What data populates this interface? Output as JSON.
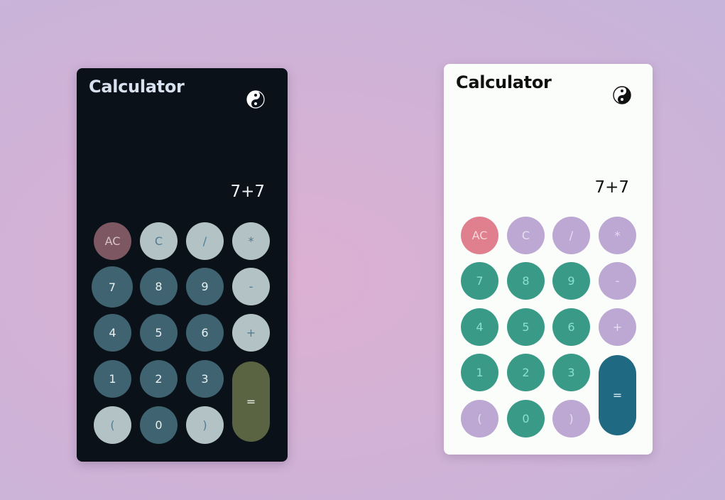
{
  "calculators": {
    "dark": {
      "title": "Calculator",
      "display": "7+7",
      "buttons": {
        "ac": "AC",
        "c": "C",
        "div": "/",
        "mul": "*",
        "n7": "7",
        "n8": "8",
        "n9": "9",
        "minus": "-",
        "n4": "4",
        "n5": "5",
        "n6": "6",
        "plus": "+",
        "n1": "1",
        "n2": "2",
        "n3": "3",
        "eq": "=",
        "lparen": "(",
        "n0": "0",
        "rparen": ")"
      },
      "colors": {
        "background": "#0b1118",
        "number": "#3f6371",
        "operator": "#b3c2c5",
        "clear": "#7d5762",
        "equals": "#5a6443"
      }
    },
    "light": {
      "title": "Calculator",
      "display": "7+7",
      "buttons": {
        "ac": "AC",
        "c": "C",
        "div": "/",
        "mul": "*",
        "n7": "7",
        "n8": "8",
        "n9": "9",
        "minus": "-",
        "n4": "4",
        "n5": "5",
        "n6": "6",
        "plus": "+",
        "n1": "1",
        "n2": "2",
        "n3": "3",
        "eq": "=",
        "lparen": "(",
        "n0": "0",
        "rparen": ")"
      },
      "colors": {
        "background": "#fbfdfa",
        "number": "#3a9a88",
        "operator": "#bca8d2",
        "clear": "#e0808f",
        "equals": "#1f6982"
      }
    }
  },
  "icons": {
    "theme_toggle": "yin-yang-icon"
  }
}
